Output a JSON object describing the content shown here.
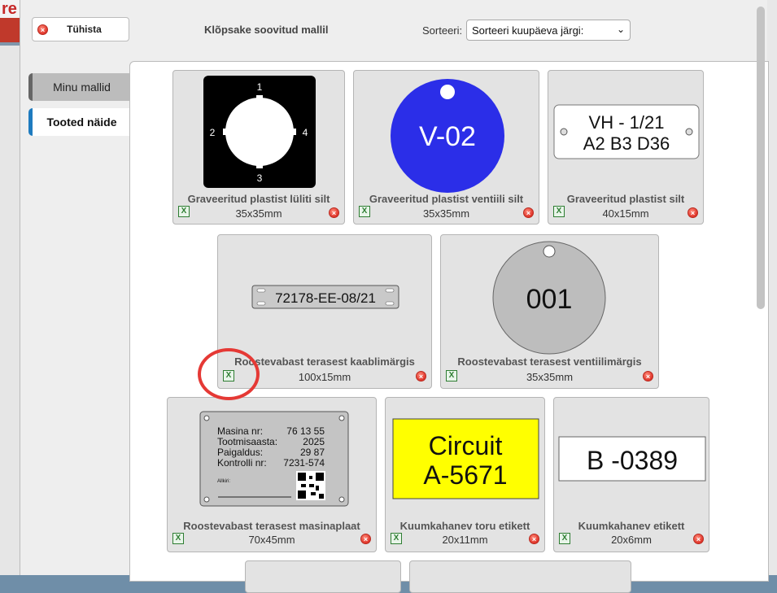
{
  "modal": {
    "cancel_label": "Tühista",
    "title": "Klõpsake soovitud mallil",
    "sort_label": "Sorteeri:",
    "sort_value": "Sorteeri kuupäeva järgi:"
  },
  "tabs": [
    {
      "label": "Minu mallid"
    },
    {
      "label": "Tooted näide"
    }
  ],
  "cards": [
    {
      "name": "Graveeritud plastist lüliti silt",
      "size": "35x35mm",
      "preview": {
        "numbers": [
          "1",
          "2",
          "3",
          "4"
        ]
      }
    },
    {
      "name": "Graveeritud plastist ventiili silt",
      "size": "35x35mm",
      "preview": {
        "text": "V-02",
        "color": "#2b2ee8"
      }
    },
    {
      "name": "Graveeritud plastist silt",
      "size": "40x15mm",
      "preview": {
        "line1": "VH - 1/21",
        "line2": "A2 B3 D36"
      }
    },
    {
      "name": "Roostevabast terasest kaablimärgis",
      "size": "100x15mm",
      "preview": {
        "text": "72178-EE-08/21"
      }
    },
    {
      "name": "Roostevabast terasest ventiilimärgis",
      "size": "35x35mm",
      "preview": {
        "text": "001"
      }
    },
    {
      "name": "Roostevabast terasest masinaplaat",
      "size": "70x45mm",
      "preview": {
        "rows": [
          {
            "k": "Masina nr:",
            "v": "76 13 55"
          },
          {
            "k": "Tootmisaasta:",
            "v": "2025"
          },
          {
            "k": "Paigaldus:",
            "v": "29 87"
          },
          {
            "k": "Kontrolli nr:",
            "v": "7231-574"
          }
        ],
        "sign": "Allkiri:"
      }
    },
    {
      "name": "Kuumkahanev toru etikett",
      "size": "20x11mm",
      "preview": {
        "line1": "Circuit",
        "line2": "A-5671",
        "color": "#ffff00"
      }
    },
    {
      "name": "Kuumkahanev etikett",
      "size": "20x6mm",
      "preview": {
        "text": "B -0389"
      }
    }
  ],
  "colors": {
    "accent": "#1e7bbf",
    "highlight": "#e53935"
  }
}
